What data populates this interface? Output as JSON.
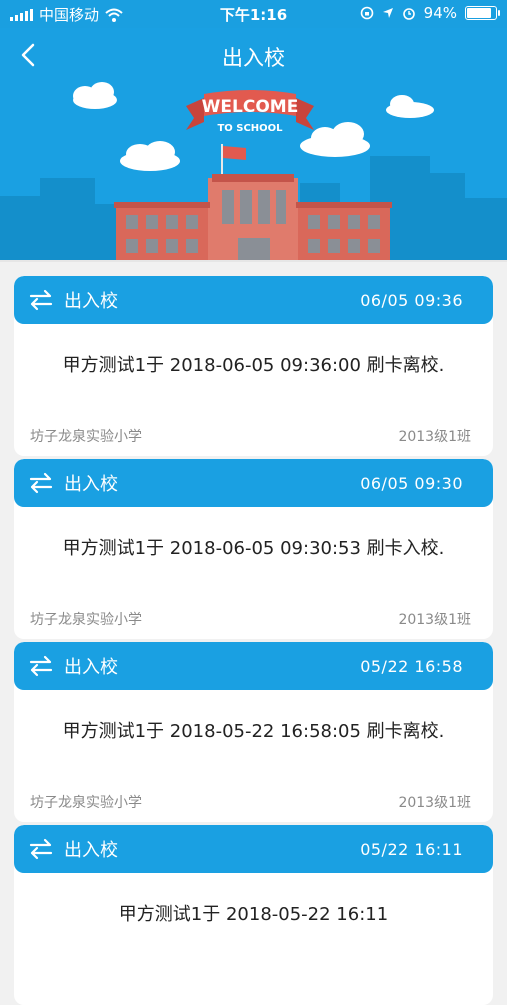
{
  "status_bar": {
    "carrier": "中国移动",
    "time": "下午1:16",
    "battery": "94%",
    "battery_level": 0.94,
    "icons": [
      "signal-icon",
      "wifi-icon",
      "screen-lock-icon",
      "location-icon",
      "alarm-icon",
      "battery-icon"
    ]
  },
  "header": {
    "title": "出入校",
    "back_icon": "chevron-left-icon",
    "banner_text_1": "WELCOME",
    "banner_text_2": "TO SCHOOL"
  },
  "colors": {
    "primary": "#1aa0e2",
    "page_bg": "#f1f1f1",
    "building": "#d9685a"
  },
  "records": [
    {
      "type": "出入校",
      "time": "06/05  09:36",
      "message": "甲方测试1于 2018-06-05 09:36:00 刷卡离校.",
      "school": "坊子龙泉实验小学",
      "class": "2013级1班"
    },
    {
      "type": "出入校",
      "time": "06/05  09:30",
      "message": "甲方测试1于 2018-06-05 09:30:53 刷卡入校.",
      "school": "坊子龙泉实验小学",
      "class": "2013级1班"
    },
    {
      "type": "出入校",
      "time": "05/22  16:58",
      "message": "甲方测试1于 2018-05-22 16:58:05 刷卡离校.",
      "school": "坊子龙泉实验小学",
      "class": "2013级1班"
    },
    {
      "type": "出入校",
      "time": "05/22  16:11",
      "message": "甲方测试1于 2018-05-22 16:11",
      "school": "",
      "class": ""
    }
  ]
}
